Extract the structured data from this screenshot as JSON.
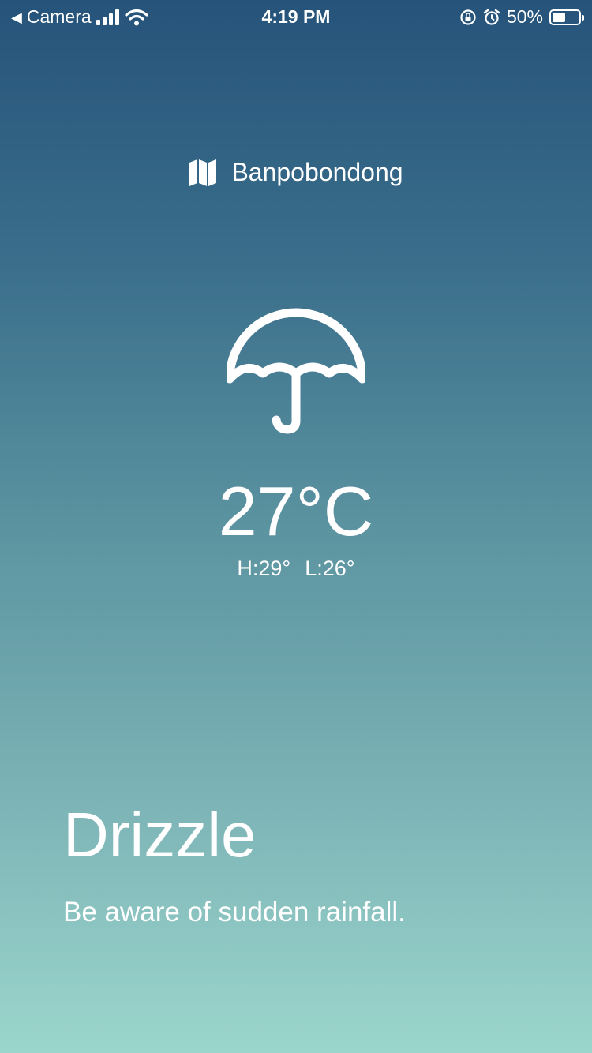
{
  "status_bar": {
    "back_app": "Camera",
    "time": "4:19 PM",
    "battery_percent": "50%",
    "battery_level": 0.5
  },
  "location": {
    "name": "Banpobondong",
    "icon": "map-icon"
  },
  "weather": {
    "icon": "umbrella-icon",
    "temperature": "27°C",
    "high": "H:29°",
    "low": "L:26°",
    "condition": "Drizzle",
    "advice": "Be aware of sudden rainfall."
  },
  "colors": {
    "gradient_top": "#26537a",
    "gradient_bottom": "#9bd6cc",
    "text": "#ffffff"
  }
}
